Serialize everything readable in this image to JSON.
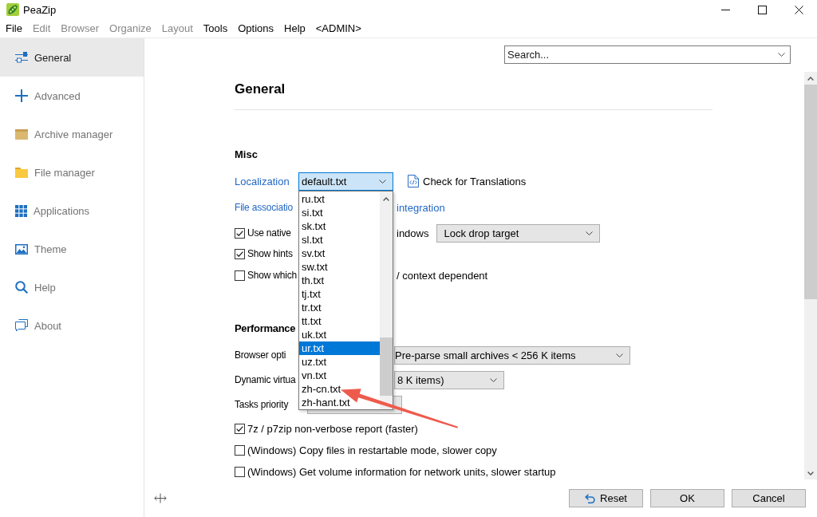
{
  "window": {
    "title": "PeaZip"
  },
  "menu": [
    {
      "label": "File",
      "disabled": false
    },
    {
      "label": "Edit",
      "disabled": true
    },
    {
      "label": "Browser",
      "disabled": true
    },
    {
      "label": "Organize",
      "disabled": true
    },
    {
      "label": "Layout",
      "disabled": true
    },
    {
      "label": "Tools",
      "disabled": false
    },
    {
      "label": "Options",
      "disabled": false
    },
    {
      "label": "Help",
      "disabled": false
    },
    {
      "label": "<ADMIN>",
      "disabled": false
    }
  ],
  "sidebar": {
    "items": [
      {
        "label": "General",
        "selected": true
      },
      {
        "label": "Advanced",
        "selected": false
      },
      {
        "label": "Archive manager",
        "selected": false
      },
      {
        "label": "File manager",
        "selected": false
      },
      {
        "label": "Applications",
        "selected": false
      },
      {
        "label": "Theme",
        "selected": false
      },
      {
        "label": "Help",
        "selected": false
      },
      {
        "label": "About",
        "selected": false
      }
    ]
  },
  "search": {
    "placeholder": "Search..."
  },
  "page": {
    "title": "General",
    "sections": [
      {
        "heading": "Misc",
        "rows": [
          {
            "kind": "select",
            "label": "Localization",
            "linked": true,
            "value": "default.txt",
            "expanded": true,
            "action": "Check for Translations",
            "options": [
              {
                "label": "ru.txt",
                "selected": false
              },
              {
                "label": "si.txt",
                "selected": false
              },
              {
                "label": "sk.txt",
                "selected": false
              },
              {
                "label": "sl.txt",
                "selected": false
              },
              {
                "label": "sv.txt",
                "selected": false
              },
              {
                "label": "sw.txt",
                "selected": false
              },
              {
                "label": "th.txt",
                "selected": false
              },
              {
                "label": "tj.txt",
                "selected": false
              },
              {
                "label": "tr.txt",
                "selected": false
              },
              {
                "label": "tt.txt",
                "selected": false
              },
              {
                "label": "uk.txt",
                "selected": false
              },
              {
                "label": "ur.txt",
                "selected": true
              },
              {
                "label": "uz.txt",
                "selected": false
              },
              {
                "label": "vn.txt",
                "selected": false
              },
              {
                "label": "zh-cn.txt",
                "selected": false
              },
              {
                "label": "zh-hant.txt",
                "selected": false
              }
            ]
          },
          {
            "kind": "link",
            "text": "File associatio",
            "text_after": "integration"
          },
          {
            "kind": "checkbox",
            "checked": true,
            "text": "Use native",
            "text_after": "indows",
            "select": "Lock drop target"
          },
          {
            "kind": "checkbox",
            "checked": true,
            "text": "Show hints"
          },
          {
            "kind": "checkbox",
            "checked": false,
            "text": "Show which",
            "text_after": "/ context dependent"
          }
        ]
      },
      {
        "heading": "Performance",
        "rows": [
          {
            "kind": "select",
            "label": "Browser opti",
            "linked": false,
            "value": "Pre-parse small archives < 256 K items"
          },
          {
            "kind": "select",
            "label": "Dynamic virtua",
            "linked": false,
            "value": "8 K items)"
          },
          {
            "kind": "select",
            "label": "Tasks priority",
            "linked": false
          },
          {
            "kind": "checkbox",
            "checked": true,
            "text": "7z / p7zip non-verbose report (faster)"
          },
          {
            "kind": "checkbox",
            "checked": false,
            "text": "(Windows) Copy files in restartable mode, slower copy"
          },
          {
            "kind": "checkbox",
            "checked": false,
            "text": "(Windows) Get volume information for network units, slower startup"
          }
        ]
      }
    ]
  },
  "buttons": [
    "Reset",
    "OK",
    "Cancel"
  ]
}
